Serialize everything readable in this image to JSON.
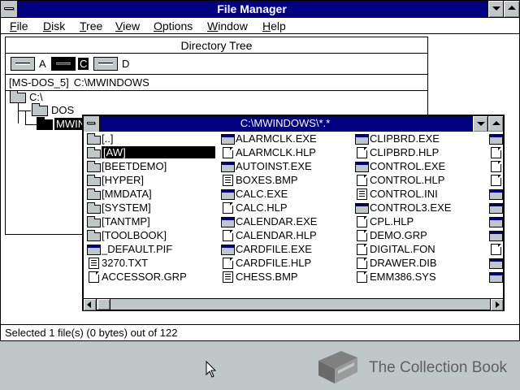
{
  "app": {
    "title": "File Manager"
  },
  "menu": [
    {
      "hot": "F",
      "rest": "ile"
    },
    {
      "hot": "D",
      "rest": "isk"
    },
    {
      "hot": "T",
      "rest": "ree"
    },
    {
      "hot": "V",
      "rest": "iew"
    },
    {
      "hot": "O",
      "rest": "ptions"
    },
    {
      "hot": "W",
      "rest": "indow"
    },
    {
      "hot": "H",
      "rest": "elp"
    }
  ],
  "tree_window": {
    "title": "Directory Tree",
    "drives": [
      "A",
      "C",
      "D"
    ],
    "selected_drive": "C",
    "volume_label": "[MS-DOS_5]",
    "current_path": "C:\\MWINDOWS",
    "nodes": [
      "C:\\",
      "DOS",
      "MWIN"
    ]
  },
  "dir_window": {
    "title": "C:\\MWINDOWS\\*.*",
    "columns": [
      [
        {
          "name": "[..]",
          "icon": "folder-icon"
        },
        {
          "name": "[AW]",
          "icon": "folder-icon",
          "selected": true
        },
        {
          "name": "[BEETDEMO]",
          "icon": "folder-icon"
        },
        {
          "name": "[HYPER]",
          "icon": "folder-icon"
        },
        {
          "name": "[MMDATA]",
          "icon": "folder-icon"
        },
        {
          "name": "[SYSTEM]",
          "icon": "folder-icon"
        },
        {
          "name": "[TANTMP]",
          "icon": "folder-icon"
        },
        {
          "name": "[TOOLBOOK]",
          "icon": "folder-icon"
        },
        {
          "name": "_DEFAULT.PIF",
          "icon": "program-icon"
        },
        {
          "name": "3270.TXT",
          "icon": "text-file-icon"
        },
        {
          "name": "ACCESSOR.GRP",
          "icon": "document-icon"
        }
      ],
      [
        {
          "name": "ALARMCLK.EXE",
          "icon": "program-icon"
        },
        {
          "name": "ALARMCLK.HLP",
          "icon": "document-icon"
        },
        {
          "name": "AUTOINST.EXE",
          "icon": "program-icon"
        },
        {
          "name": "BOXES.BMP",
          "icon": "text-file-icon"
        },
        {
          "name": "CALC.EXE",
          "icon": "program-icon"
        },
        {
          "name": "CALC.HLP",
          "icon": "document-icon"
        },
        {
          "name": "CALENDAR.EXE",
          "icon": "program-icon"
        },
        {
          "name": "CALENDAR.HLP",
          "icon": "document-icon"
        },
        {
          "name": "CARDFILE.EXE",
          "icon": "program-icon"
        },
        {
          "name": "CARDFILE.HLP",
          "icon": "document-icon"
        },
        {
          "name": "CHESS.BMP",
          "icon": "text-file-icon"
        }
      ],
      [
        {
          "name": "CLIPBRD.EXE",
          "icon": "program-icon"
        },
        {
          "name": "CLIPBRD.HLP",
          "icon": "document-icon"
        },
        {
          "name": "CONTROL.EXE",
          "icon": "program-icon"
        },
        {
          "name": "CONTROL.HLP",
          "icon": "document-icon"
        },
        {
          "name": "CONTROL.INI",
          "icon": "text-file-icon"
        },
        {
          "name": "CONTROL3.EXE",
          "icon": "program-icon"
        },
        {
          "name": "CPL.HLP",
          "icon": "document-icon"
        },
        {
          "name": "DEMO.GRP",
          "icon": "document-icon"
        },
        {
          "name": "DIGITAL.FON",
          "icon": "document-icon"
        },
        {
          "name": "DRAWER.DIB",
          "icon": "document-icon"
        },
        {
          "name": "EMM386.SYS",
          "icon": "document-icon"
        }
      ],
      [
        {
          "name": "",
          "icon": "program-icon"
        },
        {
          "name": "",
          "icon": "document-icon"
        },
        {
          "name": "",
          "icon": "document-icon"
        },
        {
          "name": "",
          "icon": "document-icon"
        },
        {
          "name": "",
          "icon": "program-icon"
        },
        {
          "name": "",
          "icon": "program-icon"
        },
        {
          "name": "",
          "icon": "program-icon"
        },
        {
          "name": "",
          "icon": "program-icon"
        },
        {
          "name": "",
          "icon": "document-icon"
        },
        {
          "name": "",
          "icon": "program-icon"
        },
        {
          "name": "",
          "icon": "program-icon"
        }
      ]
    ]
  },
  "status": {
    "text": "Selected 1 file(s) (0 bytes) out of 122"
  },
  "watermark": {
    "text": "The Collection Book"
  },
  "colors": {
    "titlebar": "#000080",
    "desktop": "#c0c7c8",
    "selection": "#000000"
  }
}
